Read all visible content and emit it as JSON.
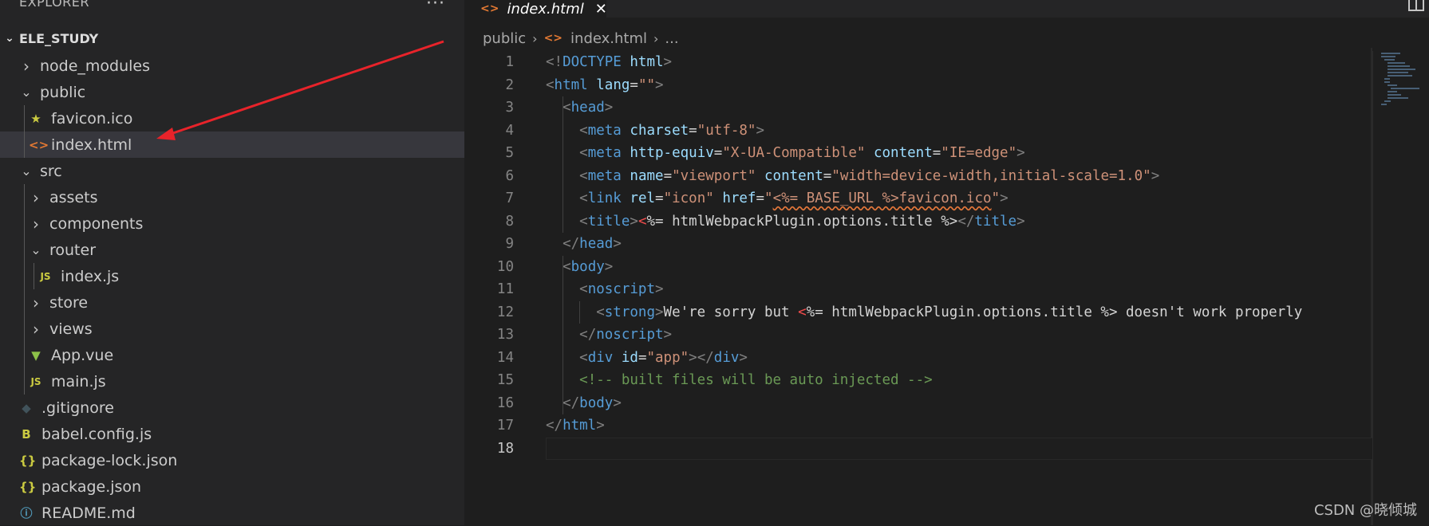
{
  "explorer": {
    "header": "EXPLORER",
    "more_label": "···",
    "project": "ELE_STUDY",
    "items": [
      {
        "label": "node_modules",
        "type": "folder",
        "expanded": false,
        "icon": "chevron-right-icon"
      },
      {
        "label": "public",
        "type": "folder",
        "expanded": true,
        "icon": "chevron-down-icon"
      },
      {
        "label": "favicon.ico",
        "type": "file",
        "icon": "star-icon",
        "icon_glyph": "★",
        "icon_color": "#cbcb41"
      },
      {
        "label": "index.html",
        "type": "file",
        "icon": "html-icon",
        "icon_glyph": "<>",
        "icon_color": "#e37933",
        "selected": true
      },
      {
        "label": "src",
        "type": "folder",
        "expanded": true,
        "icon": "chevron-down-icon"
      },
      {
        "label": "assets",
        "type": "folder",
        "expanded": false,
        "icon": "chevron-right-icon"
      },
      {
        "label": "components",
        "type": "folder",
        "expanded": false,
        "icon": "chevron-right-icon"
      },
      {
        "label": "router",
        "type": "folder",
        "expanded": true,
        "icon": "chevron-down-icon"
      },
      {
        "label": "index.js",
        "type": "file",
        "icon": "js-icon",
        "icon_glyph": "JS",
        "icon_color": "#cbcb41"
      },
      {
        "label": "store",
        "type": "folder",
        "expanded": false,
        "icon": "chevron-right-icon"
      },
      {
        "label": "views",
        "type": "folder",
        "expanded": false,
        "icon": "chevron-right-icon"
      },
      {
        "label": "App.vue",
        "type": "file",
        "icon": "vue-icon",
        "icon_glyph": "▼",
        "icon_color": "#8dc149"
      },
      {
        "label": "main.js",
        "type": "file",
        "icon": "js-icon",
        "icon_glyph": "JS",
        "icon_color": "#cbcb41"
      },
      {
        "label": ".gitignore",
        "type": "file",
        "icon": "git-icon",
        "icon_glyph": "◆",
        "icon_color": "#41535b"
      },
      {
        "label": "babel.config.js",
        "type": "file",
        "icon": "babel-icon",
        "icon_glyph": "B",
        "icon_color": "#cbcb41"
      },
      {
        "label": "package-lock.json",
        "type": "file",
        "icon": "json-icon",
        "icon_glyph": "{}",
        "icon_color": "#cbcb41"
      },
      {
        "label": "package.json",
        "type": "file",
        "icon": "json-icon",
        "icon_glyph": "{}",
        "icon_color": "#cbcb41"
      },
      {
        "label": "README.md",
        "type": "file",
        "icon": "info-icon",
        "icon_glyph": "ⓘ",
        "icon_color": "#519aba"
      }
    ]
  },
  "tab": {
    "label": "index.html",
    "icon": "html-icon",
    "icon_glyph": "<>",
    "close": "✕"
  },
  "breadcrumb": {
    "folder": "public",
    "file": "index.html",
    "rest": "..."
  },
  "editor": {
    "active_line": 18,
    "lines": [
      {
        "n": "1",
        "tokens": [
          [
            "br",
            "<!"
          ],
          [
            "tag",
            "DOCTYPE"
          ],
          [
            "txt",
            " "
          ],
          [
            "attr",
            "html"
          ],
          [
            "br",
            ">"
          ]
        ]
      },
      {
        "n": "2",
        "tokens": [
          [
            "br",
            "<"
          ],
          [
            "tag",
            "html"
          ],
          [
            "txt",
            " "
          ],
          [
            "attr",
            "lang"
          ],
          [
            "txt",
            "="
          ],
          [
            "str",
            "\"\""
          ],
          [
            "br",
            ">"
          ]
        ]
      },
      {
        "n": "3",
        "tokens": [
          [
            "txt",
            "  "
          ],
          [
            "br",
            "<"
          ],
          [
            "tag",
            "head"
          ],
          [
            "br",
            ">"
          ]
        ]
      },
      {
        "n": "4",
        "tokens": [
          [
            "txt",
            "    "
          ],
          [
            "br",
            "<"
          ],
          [
            "tag",
            "meta"
          ],
          [
            "txt",
            " "
          ],
          [
            "attr",
            "charset"
          ],
          [
            "txt",
            "="
          ],
          [
            "str",
            "\"utf-8\""
          ],
          [
            "br",
            ">"
          ]
        ]
      },
      {
        "n": "5",
        "tokens": [
          [
            "txt",
            "    "
          ],
          [
            "br",
            "<"
          ],
          [
            "tag",
            "meta"
          ],
          [
            "txt",
            " "
          ],
          [
            "attr",
            "http-equiv"
          ],
          [
            "txt",
            "="
          ],
          [
            "str",
            "\"X-UA-Compatible\""
          ],
          [
            "txt",
            " "
          ],
          [
            "attr",
            "content"
          ],
          [
            "txt",
            "="
          ],
          [
            "str",
            "\"IE=edge\""
          ],
          [
            "br",
            ">"
          ]
        ]
      },
      {
        "n": "6",
        "tokens": [
          [
            "txt",
            "    "
          ],
          [
            "br",
            "<"
          ],
          [
            "tag",
            "meta"
          ],
          [
            "txt",
            " "
          ],
          [
            "attr",
            "name"
          ],
          [
            "txt",
            "="
          ],
          [
            "str",
            "\"viewport\""
          ],
          [
            "txt",
            " "
          ],
          [
            "attr",
            "content"
          ],
          [
            "txt",
            "="
          ],
          [
            "str",
            "\"width=device-width,initial-scale=1.0\""
          ],
          [
            "br",
            ">"
          ]
        ]
      },
      {
        "n": "7",
        "tokens": [
          [
            "txt",
            "    "
          ],
          [
            "br",
            "<"
          ],
          [
            "tag",
            "link"
          ],
          [
            "txt",
            " "
          ],
          [
            "attr",
            "rel"
          ],
          [
            "txt",
            "="
          ],
          [
            "str",
            "\"icon\""
          ],
          [
            "txt",
            " "
          ],
          [
            "attr",
            "href"
          ],
          [
            "txt",
            "="
          ],
          [
            "str",
            "\""
          ],
          [
            "sq",
            "<%= BASE_URL %>favicon.ico"
          ],
          [
            "str",
            "\""
          ],
          [
            "br",
            ">"
          ]
        ]
      },
      {
        "n": "8",
        "tokens": [
          [
            "txt",
            "    "
          ],
          [
            "br",
            "<"
          ],
          [
            "tag",
            "title"
          ],
          [
            "br",
            ">"
          ],
          [
            "tplb",
            "<"
          ],
          [
            "tpl",
            "%= htmlWebpackPlugin.options.title %>"
          ],
          [
            "br",
            "</"
          ],
          [
            "tag",
            "title"
          ],
          [
            "br",
            ">"
          ]
        ]
      },
      {
        "n": "9",
        "tokens": [
          [
            "txt",
            "  "
          ],
          [
            "br",
            "</"
          ],
          [
            "tag",
            "head"
          ],
          [
            "br",
            ">"
          ]
        ]
      },
      {
        "n": "10",
        "tokens": [
          [
            "txt",
            "  "
          ],
          [
            "br",
            "<"
          ],
          [
            "tag",
            "body"
          ],
          [
            "br",
            ">"
          ]
        ]
      },
      {
        "n": "11",
        "tokens": [
          [
            "txt",
            "    "
          ],
          [
            "br",
            "<"
          ],
          [
            "tag",
            "noscript"
          ],
          [
            "br",
            ">"
          ]
        ]
      },
      {
        "n": "12",
        "tokens": [
          [
            "txt",
            "      "
          ],
          [
            "br",
            "<"
          ],
          [
            "tag",
            "strong"
          ],
          [
            "br",
            ">"
          ],
          [
            "txt",
            "We're sorry but "
          ],
          [
            "tplb",
            "<"
          ],
          [
            "txt",
            "%= htmlWebpackPlugin.options.title %> doesn't work properly"
          ]
        ]
      },
      {
        "n": "13",
        "tokens": [
          [
            "txt",
            "    "
          ],
          [
            "br",
            "</"
          ],
          [
            "tag",
            "noscript"
          ],
          [
            "br",
            ">"
          ]
        ]
      },
      {
        "n": "14",
        "tokens": [
          [
            "txt",
            "    "
          ],
          [
            "br",
            "<"
          ],
          [
            "tag",
            "div"
          ],
          [
            "txt",
            " "
          ],
          [
            "attr",
            "id"
          ],
          [
            "txt",
            "="
          ],
          [
            "str",
            "\"app\""
          ],
          [
            "br",
            "></"
          ],
          [
            "tag",
            "div"
          ],
          [
            "br",
            ">"
          ]
        ]
      },
      {
        "n": "15",
        "tokens": [
          [
            "txt",
            "    "
          ],
          [
            "com",
            "<!-- built files will be auto injected -->"
          ]
        ]
      },
      {
        "n": "16",
        "tokens": [
          [
            "txt",
            "  "
          ],
          [
            "br",
            "</"
          ],
          [
            "tag",
            "body"
          ],
          [
            "br",
            ">"
          ]
        ]
      },
      {
        "n": "17",
        "tokens": [
          [
            "br",
            "</"
          ],
          [
            "tag",
            "html"
          ],
          [
            "br",
            ">"
          ]
        ]
      },
      {
        "n": "18",
        "tokens": []
      }
    ]
  },
  "annotation": {
    "arrow_color": "#e8232a"
  },
  "watermark": "CSDN @晓倾城"
}
